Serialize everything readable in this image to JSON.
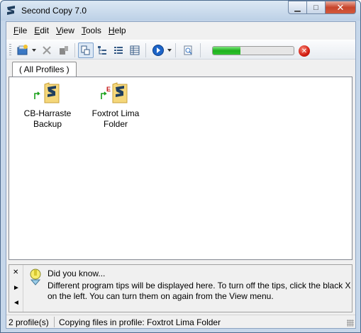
{
  "window": {
    "title": "Second Copy 7.0"
  },
  "menu": [
    {
      "label": "File",
      "accel": "F",
      "rest": "ile"
    },
    {
      "label": "Edit",
      "accel": "E",
      "rest": "dit"
    },
    {
      "label": "View",
      "accel": "V",
      "rest": "iew"
    },
    {
      "label": "Tools",
      "accel": "T",
      "rest": "ools"
    },
    {
      "label": "Help",
      "accel": "H",
      "rest": "elp"
    }
  ],
  "toolbar": {
    "progress_fraction": 0.34,
    "icons": [
      "new-profile-icon",
      "delete-icon",
      "properties-icon",
      "large-icons-view-icon",
      "tree-view-icon",
      "list-view-icon",
      "details-view-icon",
      "run-icon",
      "log-icon",
      "stop-icon"
    ]
  },
  "tabs": {
    "active": "All Profiles",
    "active_display": "(  All Profiles  )"
  },
  "profiles": [
    {
      "line1": "CB-Harraste",
      "line2": "Backup",
      "badge": ""
    },
    {
      "line1": "Foxtrot Lima",
      "line2": "Folder",
      "badge": "E"
    }
  ],
  "tips": {
    "title": "Did you know...",
    "body": "Different program tips will be displayed here. To turn off the tips, click the black X on the left. You can turn them on again from the View menu.",
    "nav": [
      "✕",
      "►",
      "◄"
    ]
  },
  "status": {
    "count": "2 profile(s)",
    "message": "Copying files in profile: Foxtrot Lima Folder"
  },
  "colors": {
    "accent": "#1e3f5f",
    "progress": "#1eb01e",
    "stop": "#d21c10"
  }
}
